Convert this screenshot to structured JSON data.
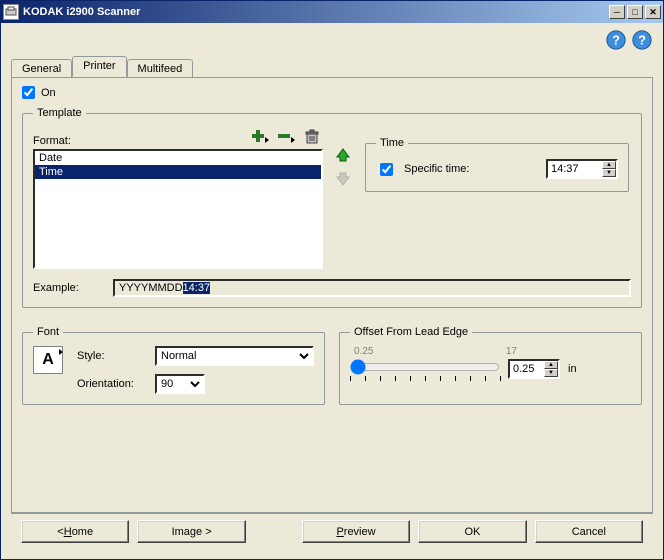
{
  "window": {
    "title": "KODAK i2900 Scanner"
  },
  "tabs": {
    "general": "General",
    "printer": "Printer",
    "multifeed": "Multifeed",
    "active": "printer"
  },
  "on": {
    "label": "On",
    "checked": true
  },
  "template": {
    "legend": "Template",
    "format_label": "Format:",
    "items": [
      "Date",
      "Time"
    ],
    "selected_index": 1,
    "example_label": "Example:",
    "example_plain": "YYYYMMDD",
    "example_highlight": "14:37",
    "icons": {
      "add": "add-icon",
      "remove": "remove-icon",
      "delete": "trash-icon",
      "up": "move-up-icon",
      "down": "move-down-icon"
    }
  },
  "time": {
    "legend": "Time",
    "specific_label": "Specific time:",
    "specific_checked": true,
    "value": "14:37"
  },
  "font": {
    "legend": "Font",
    "style_label": "Style:",
    "style_value": "Normal",
    "orientation_label": "Orientation:",
    "orientation_value": "90",
    "glyph": "A"
  },
  "offset": {
    "legend": "Offset From Lead Edge",
    "min_label": "0.25",
    "max_label": "17",
    "value": "0.25",
    "unit": "in"
  },
  "footer": {
    "home": "Home",
    "image": "Image >",
    "preview": "Preview",
    "ok": "OK",
    "cancel": "Cancel"
  }
}
